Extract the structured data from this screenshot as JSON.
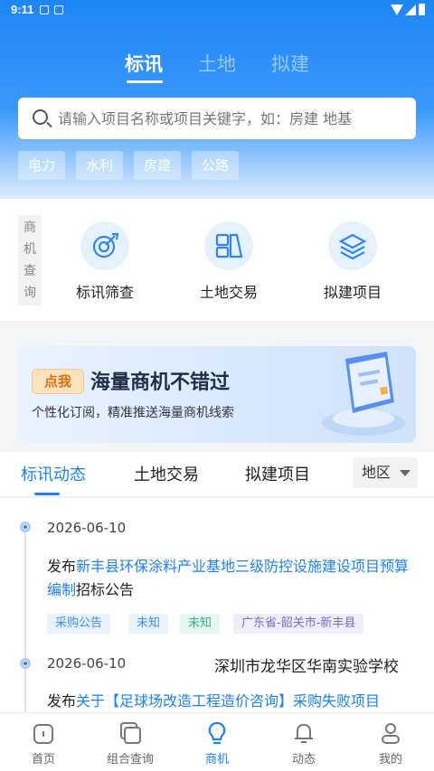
{
  "status_bar": {
    "time": "9:11"
  },
  "top_tabs": [
    {
      "label": "标讯",
      "active": true
    },
    {
      "label": "土地",
      "active": false
    },
    {
      "label": "拟建",
      "active": false
    }
  ],
  "search": {
    "placeholder": "请输入项目名称或项目关键字，如：房建 地基"
  },
  "chips": [
    "电力",
    "水利",
    "房建",
    "公路"
  ],
  "quick_query": {
    "label": "商机查询",
    "items": [
      {
        "label": "标讯筛查",
        "icon": "target-pen-icon"
      },
      {
        "label": "土地交易",
        "icon": "land-map-icon"
      },
      {
        "label": "拟建项目",
        "icon": "layers-icon"
      }
    ]
  },
  "banner": {
    "badge": "点我",
    "title": "海量商机不错过",
    "subtitle": "个性化订阅，精准推送海量商机线索"
  },
  "feed_tabs": {
    "items": [
      {
        "label": "标讯动态",
        "active": true
      },
      {
        "label": "土地交易",
        "active": false
      },
      {
        "label": "拟建项目",
        "active": false
      }
    ],
    "region": "地区"
  },
  "feed": [
    {
      "date": "2026-06-10",
      "prefix": "发布",
      "link": "新丰县环保涂料产业基地三级防控设施建设项目预算编制",
      "suffix": "招标公告",
      "tags": [
        {
          "text": "采购公告",
          "style": "blue"
        },
        {
          "text": "未知",
          "style": "blue"
        },
        {
          "text": "未知",
          "style": "green"
        },
        {
          "text": "广东省-韶关市-新丰县",
          "style": "purple"
        }
      ]
    },
    {
      "date": "2026-06-10",
      "school": "深圳市龙华区华南实验学校",
      "prefix": "发布",
      "link": "关于【足球场改造工程造价咨询】采购失败项目"
    }
  ],
  "bottom_nav": [
    {
      "label": "首页",
      "icon": "home-icon",
      "active": false
    },
    {
      "label": "组合查询",
      "icon": "combo-query-icon",
      "active": false
    },
    {
      "label": "商机",
      "icon": "lightbulb-icon",
      "active": true
    },
    {
      "label": "动态",
      "icon": "bell-icon",
      "active": false
    },
    {
      "label": "我的",
      "icon": "user-icon",
      "active": false
    }
  ],
  "colors": {
    "primary": "#1a82f3",
    "header_top": "#1e86f5"
  }
}
